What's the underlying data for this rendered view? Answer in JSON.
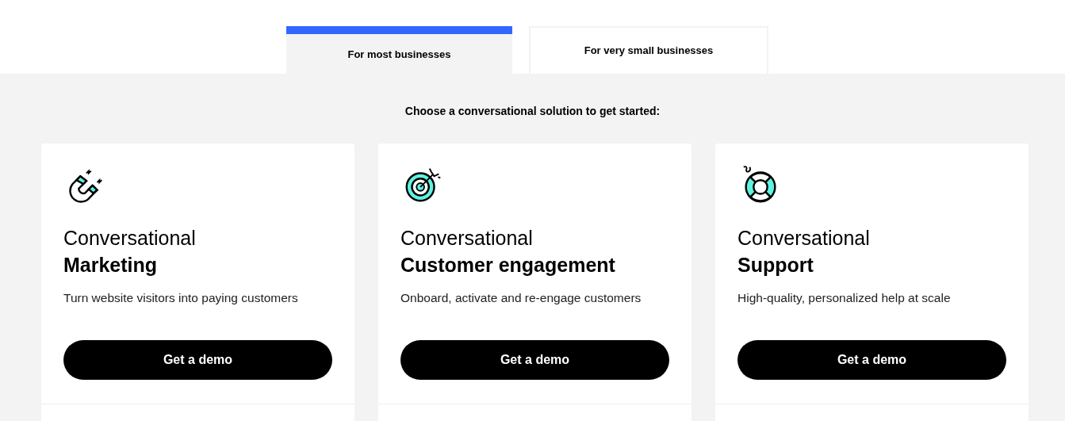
{
  "tabs": [
    {
      "label": "For most businesses",
      "selected": true
    },
    {
      "label": "For very small businesses",
      "selected": false
    }
  ],
  "heading": "Choose a conversational solution to get started:",
  "cards": [
    {
      "kind": "magnet",
      "title_light": "Conversational",
      "title_bold": "Marketing",
      "description": "Turn website visitors into paying customers",
      "button": "Get a demo"
    },
    {
      "kind": "target",
      "title_light": "Conversational",
      "title_bold": "Customer engagement",
      "description": "Onboard, activate and re-engage customers",
      "button": "Get a demo"
    },
    {
      "kind": "lifebuoy",
      "title_light": "Conversational",
      "title_bold": "Support",
      "description": "High-quality, personalized help at scale",
      "button": "Get a demo"
    }
  ]
}
